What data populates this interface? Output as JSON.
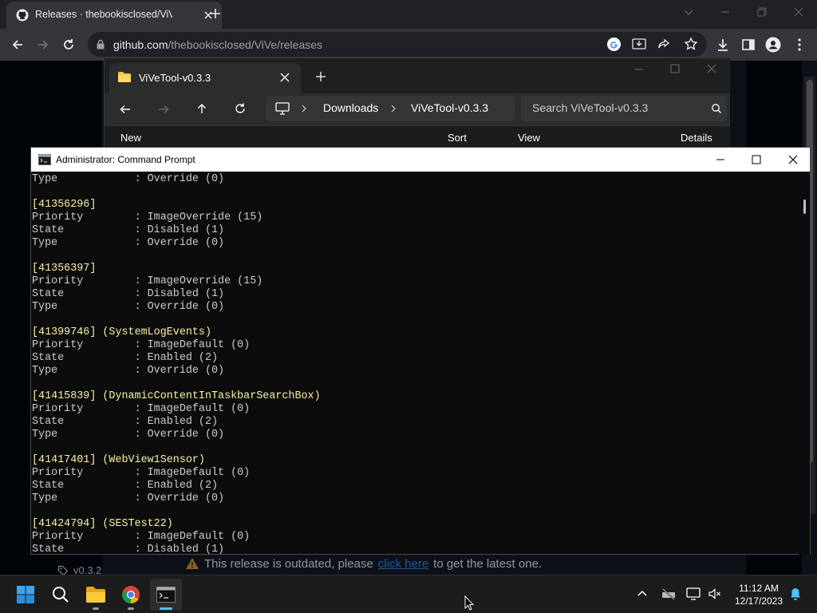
{
  "browser": {
    "tab_title": "Releases · thebookisclosed/ViVe",
    "url_host": "github.com",
    "url_path": "/thebookisclosed/ViVe/releases"
  },
  "github": {
    "banner_prefix": "This release is outdated, please",
    "banner_link": "click here",
    "banner_suffix": "to get the latest one.",
    "tag_label": "v0.3.2"
  },
  "explorer": {
    "tab_title": "ViVeTool-v0.3.3",
    "crumbs": [
      "Downloads",
      "ViVeTool-v0.3.3"
    ],
    "search_placeholder": "Search ViVeTool-v0.3.3",
    "cmd_new": "New",
    "cmd_sort": "Sort",
    "cmd_view": "View",
    "cmd_details": "Details"
  },
  "cmd": {
    "title": "Administrator: Command Prompt",
    "lines": [
      {
        "t": "Type            : Override (0)",
        "h": false
      },
      {
        "t": "",
        "h": false
      },
      {
        "t": "[41356296]",
        "h": true
      },
      {
        "t": "Priority        : ImageOverride (15)",
        "h": false
      },
      {
        "t": "State           : Disabled (1)",
        "h": false
      },
      {
        "t": "Type            : Override (0)",
        "h": false
      },
      {
        "t": "",
        "h": false
      },
      {
        "t": "[41356397]",
        "h": true
      },
      {
        "t": "Priority        : ImageOverride (15)",
        "h": false
      },
      {
        "t": "State           : Disabled (1)",
        "h": false
      },
      {
        "t": "Type            : Override (0)",
        "h": false
      },
      {
        "t": "",
        "h": false
      },
      {
        "t": "[41399746] (SystemLogEvents)",
        "h": true
      },
      {
        "t": "Priority        : ImageDefault (0)",
        "h": false
      },
      {
        "t": "State           : Enabled (2)",
        "h": false
      },
      {
        "t": "Type            : Override (0)",
        "h": false
      },
      {
        "t": "",
        "h": false
      },
      {
        "t": "[41415839] (DynamicContentInTaskbarSearchBox)",
        "h": true
      },
      {
        "t": "Priority        : ImageDefault (0)",
        "h": false
      },
      {
        "t": "State           : Enabled (2)",
        "h": false
      },
      {
        "t": "Type            : Override (0)",
        "h": false
      },
      {
        "t": "",
        "h": false
      },
      {
        "t": "[41417401] (WebView1Sensor)",
        "h": true
      },
      {
        "t": "Priority        : ImageDefault (0)",
        "h": false
      },
      {
        "t": "State           : Enabled (2)",
        "h": false
      },
      {
        "t": "Type            : Override (0)",
        "h": false
      },
      {
        "t": "",
        "h": false
      },
      {
        "t": "[41424794] (SESTest22)",
        "h": true
      },
      {
        "t": "Priority        : ImageDefault (0)",
        "h": false
      },
      {
        "t": "State           : Disabled (1)",
        "h": false
      }
    ]
  },
  "taskbar": {
    "time": "11:12 AM",
    "date": "12/17/2023"
  }
}
